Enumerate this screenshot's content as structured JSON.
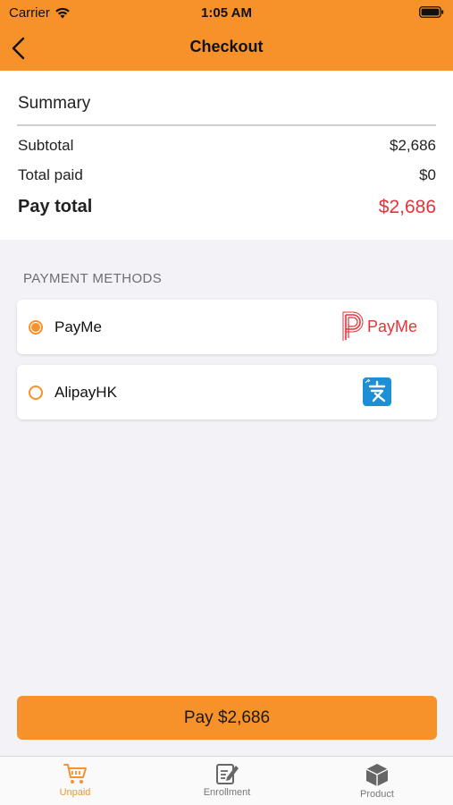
{
  "status_bar": {
    "carrier": "Carrier",
    "time": "1:05 AM"
  },
  "navbar": {
    "title": "Checkout",
    "back_icon": "chevron-left-icon"
  },
  "summary": {
    "title": "Summary",
    "rows": [
      {
        "label": "Subtotal",
        "value": "$2,686"
      },
      {
        "label": "Total paid",
        "value": "$0"
      },
      {
        "label": "Pay total",
        "value": "$2,686"
      }
    ]
  },
  "payment_methods": {
    "section_label": "PAYMENT METHODS",
    "items": [
      {
        "label": "PayMe",
        "selected": true,
        "logo_text": "PayMe"
      },
      {
        "label": "AlipayHK",
        "selected": false
      }
    ]
  },
  "pay_button": {
    "label": "Pay $2,686"
  },
  "tabbar": {
    "items": [
      {
        "label": "Unpaid",
        "active": true,
        "icon": "cart-icon"
      },
      {
        "label": "Enrollment",
        "active": false,
        "icon": "edit-document-icon"
      },
      {
        "label": "Product",
        "active": false,
        "icon": "box-icon"
      }
    ]
  },
  "colors": {
    "accent": "#f7922a",
    "total_red": "#e8323a",
    "background": "#f2f2f7"
  }
}
